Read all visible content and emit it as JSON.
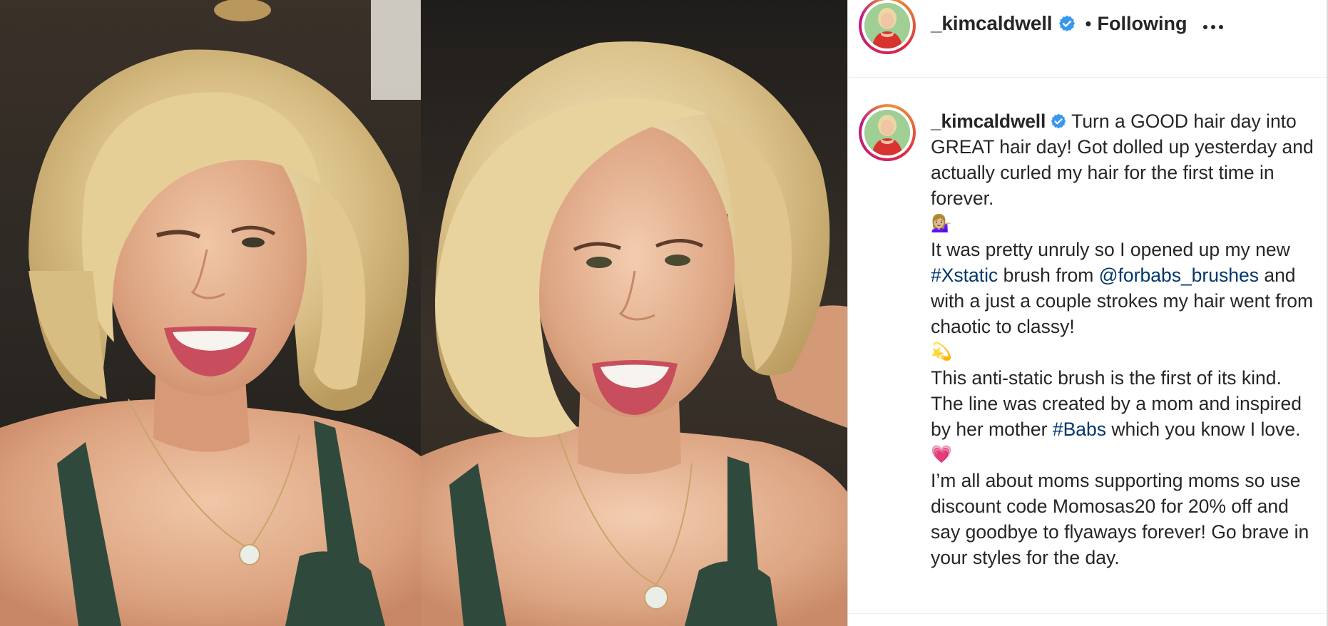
{
  "post": {
    "username": "_kimcaldwell",
    "separator": "•",
    "follow_state": "Following",
    "more_label": "..."
  },
  "caption": {
    "username": "_kimcaldwell",
    "paragraphs": [
      {
        "segments": [
          {
            "type": "text",
            "text": "Turn a GOOD hair day into GREAT hair day! Got dolled up yesterday and actually curled my hair for the first time in forever."
          }
        ]
      },
      {
        "emoji": "💁🏼‍♀️"
      },
      {
        "segments": [
          {
            "type": "text",
            "text": "It was pretty unruly so I opened up my new "
          },
          {
            "type": "tag",
            "text": "#Xstatic"
          },
          {
            "type": "text",
            "text": " brush from "
          },
          {
            "type": "tag",
            "text": "@forbabs_brushes"
          },
          {
            "type": "text",
            "text": " and with a just a couple strokes my hair went from chaotic to classy!"
          }
        ]
      },
      {
        "emoji": "💫"
      },
      {
        "segments": [
          {
            "type": "text",
            "text": "This anti-static brush is the first of its kind. The line was created by a mom and inspired by her mother "
          },
          {
            "type": "tag",
            "text": "#Babs"
          },
          {
            "type": "text",
            "text": " which you know I love."
          }
        ]
      },
      {
        "emoji": "💗"
      },
      {
        "segments": [
          {
            "type": "text",
            "text": "I’m all about moms supporting moms so use discount code Momosas20 for 20% off and say goodbye to flyaways forever! Go brave in your styles for the day."
          }
        ]
      }
    ]
  },
  "icons": {
    "verified": "verified-badge-icon",
    "more": "more-options-icon"
  },
  "colors": {
    "text": "#262626",
    "link": "#00376b",
    "verified_blue": "#3897f0",
    "border": "#dbdbdb"
  }
}
